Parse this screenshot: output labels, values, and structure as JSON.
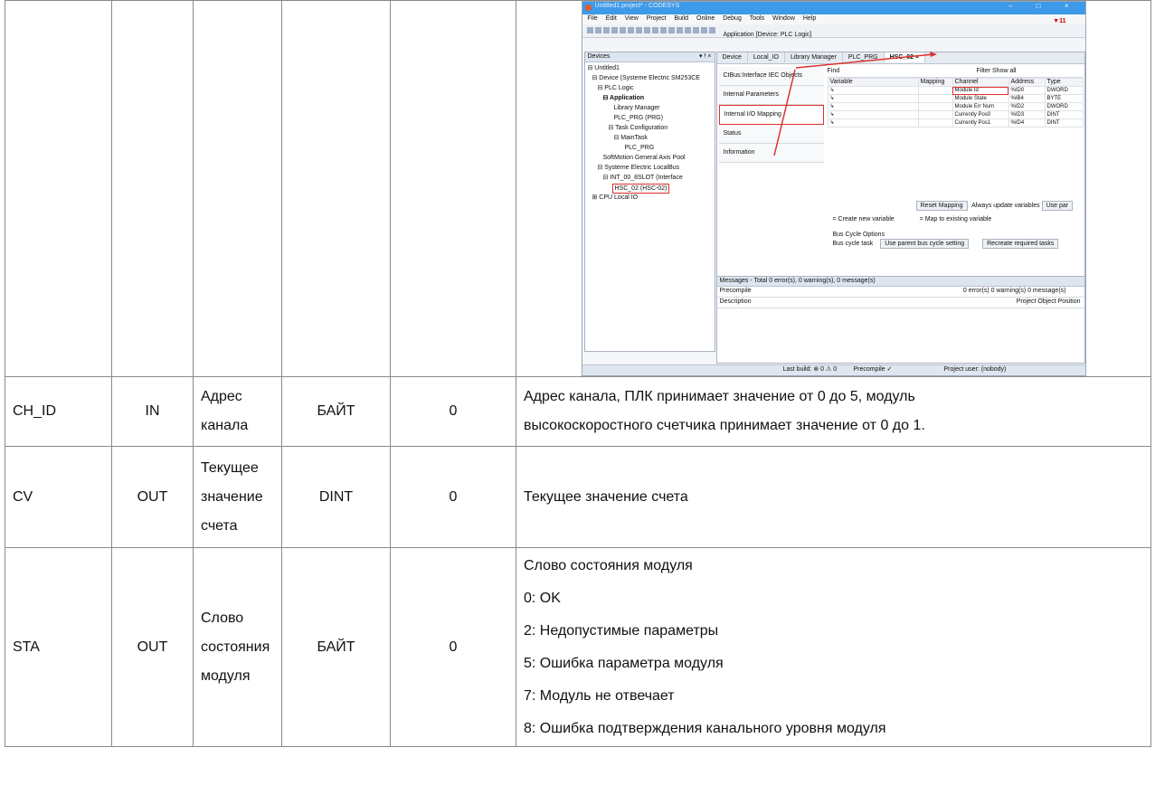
{
  "screenshot": {
    "window_title": "Untitled1.project* - CODESYS",
    "window_controls": "–  □  ×",
    "menu": [
      "File",
      "Edit",
      "View",
      "Project",
      "Build",
      "Online",
      "Debug",
      "Tools",
      "Window",
      "Help"
    ],
    "menu_flag": "▼11",
    "toolbar_app": "Application [Device: PLC Logic]",
    "devices_title": "Devices",
    "devices_controls": "▾ ⵑ ×",
    "tree": [
      "⊟ Untitled1",
      "⊟ Device (Systeme Electric SM253CE",
      "⊟ PLC Logic",
      "⊟ Application",
      "Library Manager",
      "PLC_PRG (PRG)",
      "⊟ Task Configuration",
      "⊟ MainTask",
      "PLC_PRG",
      "SoftMotion General Axis Pool",
      "⊟ Systeme Electric LocalBus",
      "⊟ INT_00_8SLOT (Interface",
      "HSC_02 (HSC-02)",
      "⊞ CPU Local IO"
    ],
    "tabs": [
      "Device",
      "Local_IO",
      "Library Manager",
      "PLC_PRG",
      "HSC_02 ×"
    ],
    "left_nav": [
      "CtBus:Interface IEC Objects",
      "Internal Parameters",
      "Internal I/O Mapping",
      "Status",
      "Information"
    ],
    "find_label": "Find",
    "filter_label": "Filter",
    "show_all": "Show all",
    "grid_headers": [
      "Variable",
      "Mapping",
      "Channel",
      "Address",
      "Type"
    ],
    "grid_rows": [
      [
        "Module Id",
        "%ID0",
        "DWORD"
      ],
      [
        "Module State",
        "%IB4",
        "BYTE"
      ],
      [
        "Module Err Num",
        "%ID2",
        "DWORD"
      ],
      [
        "Currently Pos0",
        "%ID3",
        "DINT"
      ],
      [
        "Currently Pos1",
        "%ID4",
        "DINT"
      ]
    ],
    "reset_mapping": "Reset Mapping",
    "always_update": "Always update variables",
    "use_parent": "Use par",
    "create_new": "= Create new variable",
    "map_existing": "= Map to existing variable",
    "bus_cycle_options": "Bus Cycle Options",
    "bus_cycle_task": "Bus cycle task",
    "bus_cycle_setting": "Use parent bus cycle setting",
    "recreate_tasks": "Recreate required tasks",
    "messages_title": "Messages - Total 0 error(s), 0 warning(s), 0 message(s)",
    "precompile": "Precompile",
    "msg_counts": "0 error(s)  0 warning(s)  0 message(s)",
    "description": "Description",
    "msg_cols": "Project   Object   Position",
    "status_last_build": "Last build: ⊗ 0 ⚠ 0",
    "status_precompile": "Precompile ✓",
    "status_user": "Project user: (nobody)"
  },
  "rows": [
    {
      "name": "CH_ID",
      "direction": "IN",
      "label_lines": [
        "Адрес",
        "канала"
      ],
      "type": "БАЙТ",
      "initial": "0",
      "description_lines": [
        "Адрес канала, ПЛК принимает значение от 0 до 5, модуль",
        "высокоскоростного счетчика принимает значение от 0 до 1."
      ]
    },
    {
      "name": "CV",
      "direction": "OUT",
      "label_lines": [
        "Текущее",
        "значение",
        "счета"
      ],
      "type": "DINT",
      "initial": "0",
      "description_lines": [
        "Текущее значение счета"
      ]
    },
    {
      "name": "STA",
      "direction": "OUT",
      "label_lines": [
        "Слово",
        "состояния",
        "модуля"
      ],
      "type": "БАЙТ",
      "initial": "0",
      "description_lines": [
        "Слово состояния модуля",
        "0: OK",
        "2: Недопустимые параметры",
        "5: Ошибка параметра модуля",
        "7: Модуль не отвечает",
        "8: Ошибка подтверждения канального уровня модуля"
      ]
    }
  ]
}
